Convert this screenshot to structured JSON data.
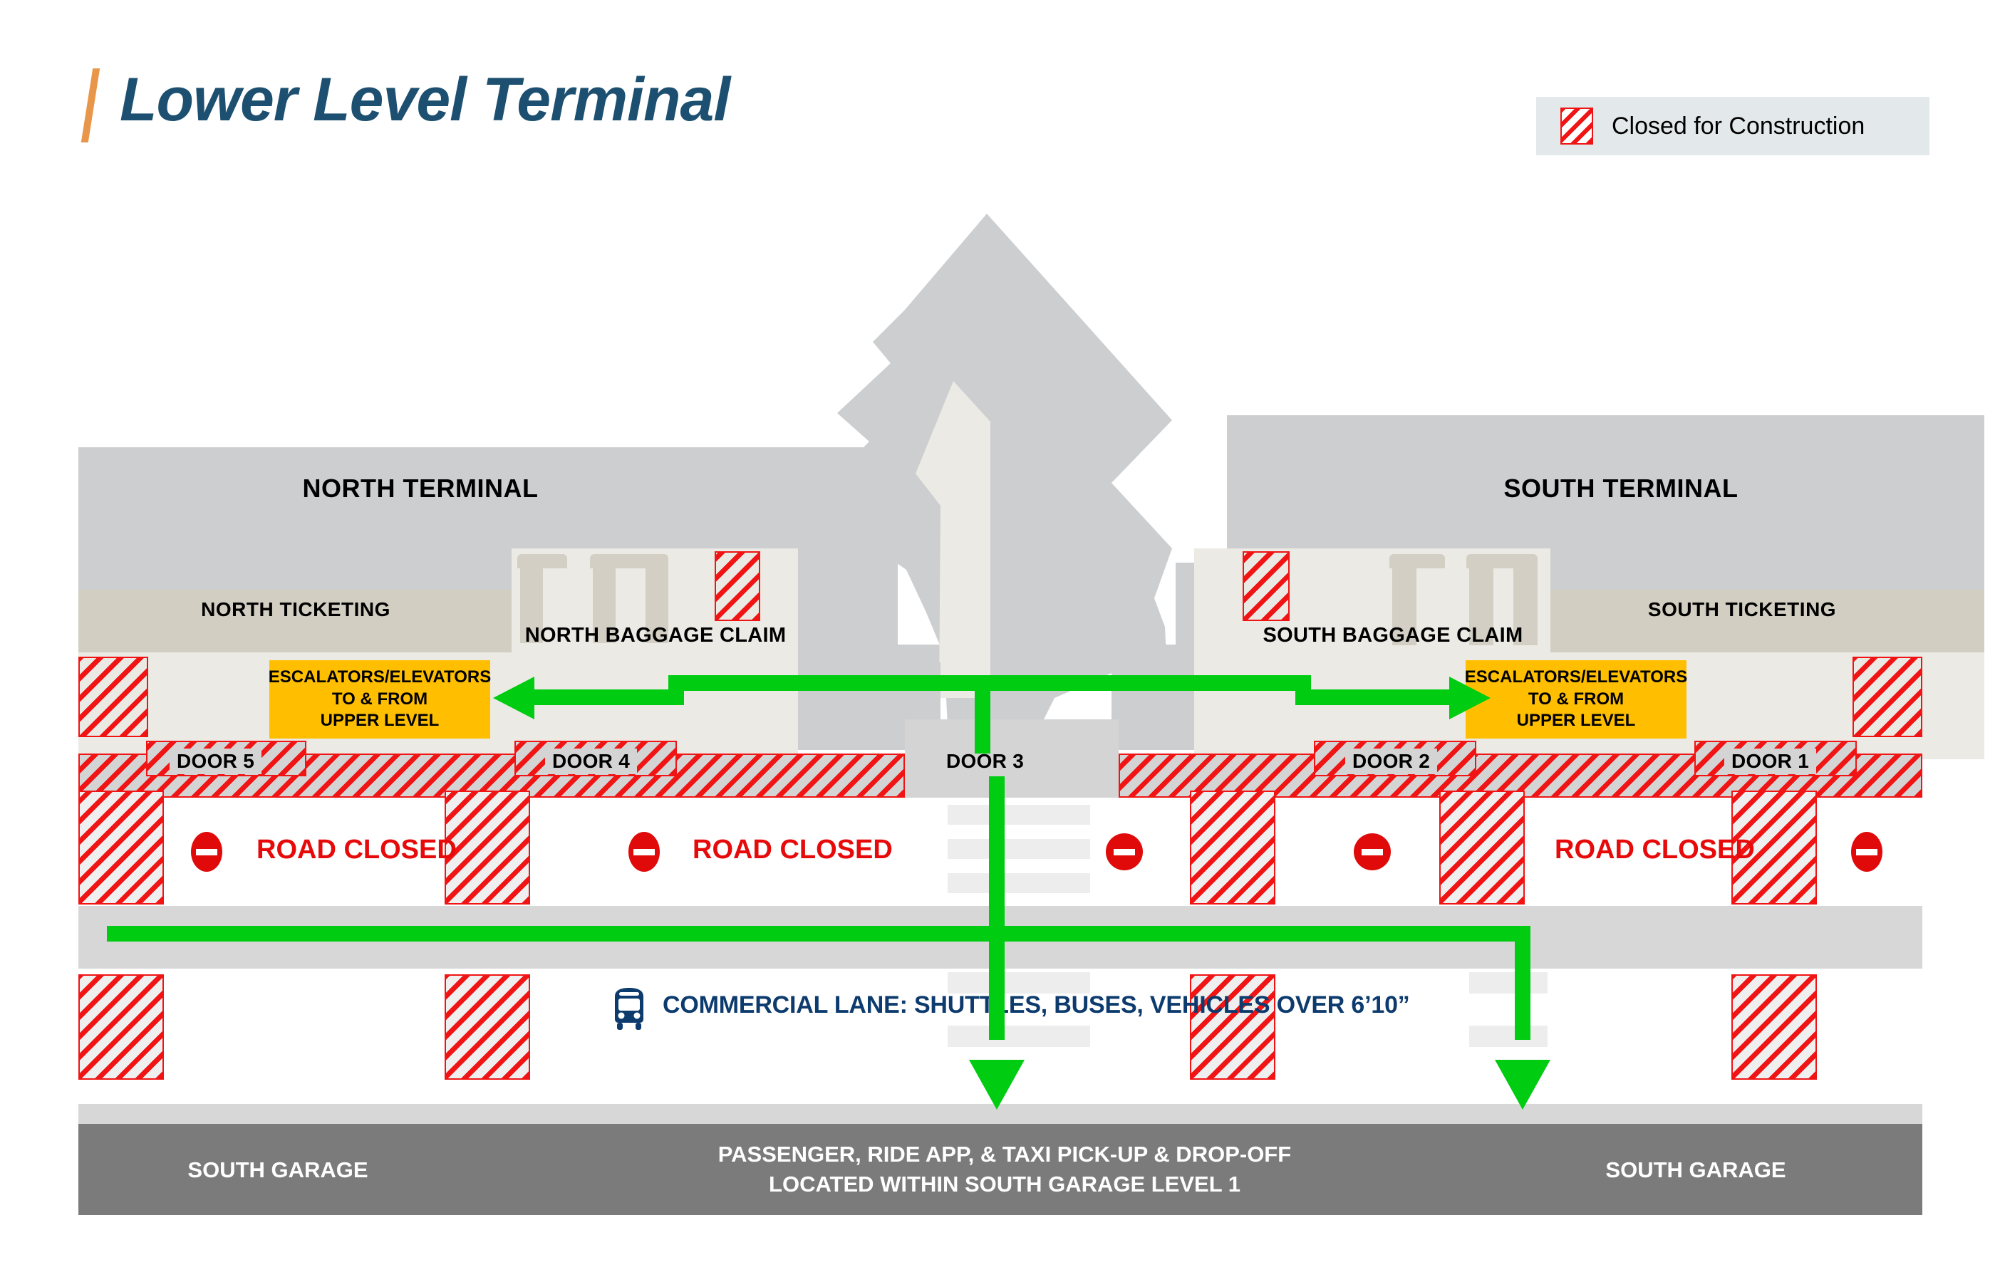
{
  "header": {
    "title": "Lower Level Terminal",
    "legend": {
      "label": "Closed for Construction",
      "swatch_icon": "construction-hatch-icon",
      "swatch_color": "#f01414",
      "background": "#e3e8ea"
    },
    "accent_color": "#e8974a",
    "title_color": "#1d5070"
  },
  "map": {
    "terminals": [
      {
        "name": "NORTH TERMINAL"
      },
      {
        "name": "SOUTH TERMINAL"
      }
    ],
    "ticketing": [
      {
        "name": "NORTH TICKETING"
      },
      {
        "name": "SOUTH TICKETING"
      }
    ],
    "baggage_claim": [
      {
        "name": "NORTH BAGGAGE CLAIM"
      },
      {
        "name": "SOUTH BAGGAGE CLAIM"
      }
    ],
    "escalator_callouts": [
      {
        "line1": "ESCALATORS/ELEVATORS",
        "line2": "TO & FROM",
        "line3": "UPPER LEVEL"
      },
      {
        "line1": "ESCALATORS/ELEVATORS",
        "line2": "TO & FROM",
        "line3": "UPPER LEVEL"
      }
    ],
    "doors": [
      {
        "label": "DOOR 5"
      },
      {
        "label": "DOOR 4"
      },
      {
        "label": "DOOR 3"
      },
      {
        "label": "DOOR 2"
      },
      {
        "label": "DOOR 1"
      }
    ],
    "road_closed_signs": [
      {
        "label": "ROAD CLOSED"
      },
      {
        "label": "ROAD CLOSED"
      },
      {
        "label": "ROAD CLOSED"
      }
    ],
    "no_entry_icons_count": 5,
    "commercial_lane": {
      "icon": "bus-icon",
      "label": "COMMERCIAL LANE: SHUTTLES, BUSES, VEHICLES OVER 6’10”",
      "color": "#0d3b6e"
    },
    "garage": [
      {
        "label": "SOUTH GARAGE"
      },
      {
        "label": "SOUTH GARAGE"
      }
    ],
    "garage_note": {
      "line1": "PASSENGER, RIDE APP, & TAXI PICK-UP & DROP-OFF",
      "line2": "LOCATED WITHIN SOUTH GARAGE LEVEL 1"
    },
    "colors": {
      "building": "#ccced0",
      "ticketing": "#d3cec2",
      "concourse": "#eceae4",
      "road": "#ffffff",
      "median": "#d7d7d7",
      "garage": "#7b7b7b",
      "wayfinding_path": "#00cc11",
      "closed_hatch": "#f01414",
      "callout": "#ffbf00"
    }
  }
}
